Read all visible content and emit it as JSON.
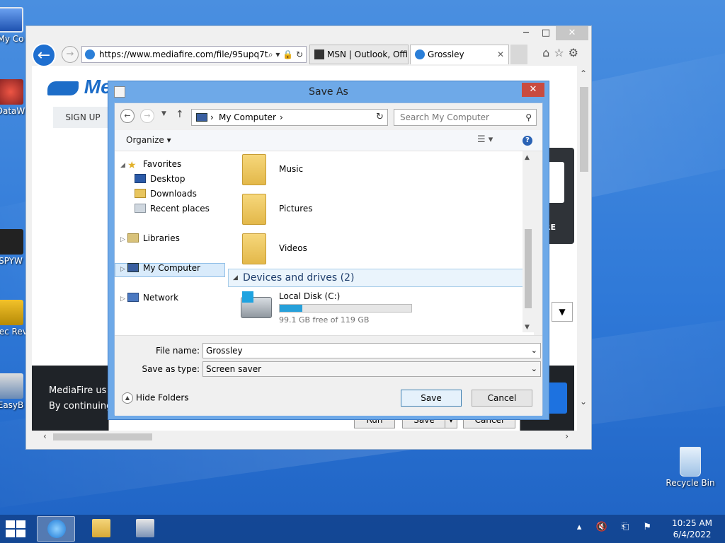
{
  "desktop": {
    "icons": [
      {
        "label": "My Co"
      },
      {
        "label": "DataW"
      },
      {
        "label": "SPYW"
      },
      {
        "label": "Sec Rev"
      },
      {
        "label": "EasyB"
      },
      {
        "label": "Recycle Bin"
      }
    ]
  },
  "browser": {
    "address": "https://www.mediafire.com/file/95upq7t",
    "address_tools": "⌕ ▾ 🔒 ↻",
    "tabs": [
      {
        "label": "MSN | Outlook, Offi..."
      },
      {
        "label": "Grossley",
        "close": "✕"
      }
    ],
    "tool_icons": "⌂☆⚙",
    "page": {
      "logo_text": "Me",
      "signup_label": "SIGN UP",
      "dark_panel_text": "RE",
      "cookie_line1": "MediaFire us",
      "cookie_line2": "By continuing"
    },
    "download_bar": {
      "run_label": "Run",
      "save_label": "Save",
      "save_arrow": "▾",
      "cancel_label": "Cancel"
    }
  },
  "dialog": {
    "title": "Save As",
    "close_glyph": "✕",
    "breadcrumb": {
      "location": "My Computer"
    },
    "search_placeholder": "Search My Computer",
    "organize_label": "Organize ▾",
    "help_glyph": "?",
    "nav_items": [
      {
        "label": "Favorites"
      },
      {
        "label": "Desktop"
      },
      {
        "label": "Downloads"
      },
      {
        "label": "Recent places"
      },
      {
        "label": "Libraries"
      },
      {
        "label": "My Computer"
      },
      {
        "label": "Network"
      }
    ],
    "folders": [
      {
        "label": "Music"
      },
      {
        "label": "Pictures"
      },
      {
        "label": "Videos"
      }
    ],
    "group_header": "Devices and drives (2)",
    "drive": {
      "name": "Local Disk (C:)",
      "free_text": "99.1 GB free of 119 GB",
      "used_fraction": 0.17
    },
    "file_name_label": "File name:",
    "file_name_value": "Grossley",
    "save_type_label": "Save as type:",
    "save_type_value": "Screen saver",
    "hide_folders_label": "Hide Folders",
    "save_button": "Save",
    "cancel_button": "Cancel"
  },
  "taskbar": {
    "clock_time": "10:25 AM",
    "clock_date": "6/4/2022",
    "tray_icons": "▴ 🔇 ⎗ ⚑"
  }
}
